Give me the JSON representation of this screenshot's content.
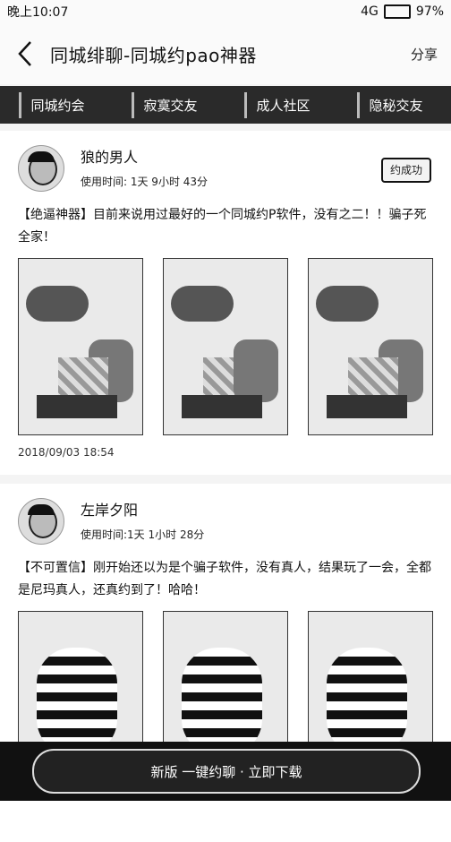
{
  "status_bar": {
    "time": "晚上10:07",
    "signal": "4G",
    "battery": "97%"
  },
  "nav": {
    "title": "同城绯聊-同城约pao神器",
    "share": "分享"
  },
  "tabs": [
    {
      "label": "同城约会"
    },
    {
      "label": "寂寞交友"
    },
    {
      "label": "成人社区"
    },
    {
      "label": "隐秘交友"
    }
  ],
  "posts": [
    {
      "name": "狼的男人",
      "usage": "使用时间: 1天 9小时 43分",
      "badge": "约成功",
      "text": "【绝逼神器】目前来说用过最好的一个同城约P软件，没有之二！！骗子死全家！",
      "date": "2018/09/03 18:54"
    },
    {
      "name": "左岸夕阳",
      "usage": "使用时间:1天 1小时 28分",
      "badge": "",
      "text": "【不可置信】刚开始还以为是个骗子软件，没有真人，结果玩了一会，全都是尼玛真人，还真约到了！哈哈！"
    }
  ],
  "bottom": {
    "button_label": "新版 一键约聊 · 立即下载"
  }
}
